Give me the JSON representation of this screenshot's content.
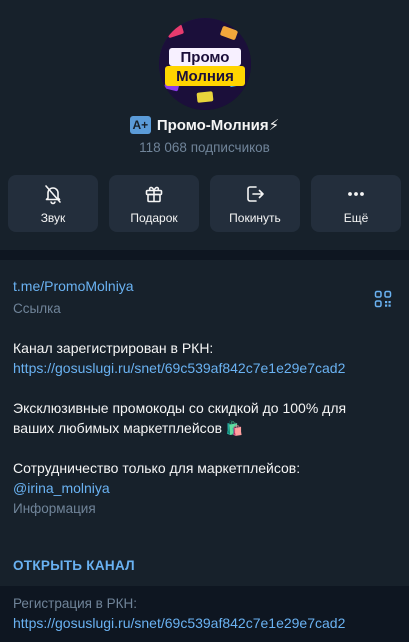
{
  "channel": {
    "title": "Промо-Молния⚡",
    "subscribers": "118 068 подписчиков",
    "badge": "A+",
    "avatar_lines": [
      "Промо",
      "Молния"
    ]
  },
  "actions": [
    {
      "label": "Звук",
      "icon": "bell-off-icon"
    },
    {
      "label": "Подарок",
      "icon": "gift-icon"
    },
    {
      "label": "Покинуть",
      "icon": "leave-icon"
    },
    {
      "label": "Ещё",
      "icon": "more-icon"
    }
  ],
  "info": {
    "link": "t.me/PromoMolniya",
    "link_caption": "Ссылка",
    "desc_line1": "Канал зарегистрирован в РКН:",
    "desc_link1": "https://gosuslugi.ru/snet/69c539af842c7e1e29e7cad2",
    "desc_line2": "Эксклюзивные промокоды со скидкой до 100% для",
    "desc_line3": "ваших любимых маркетплейсов 🛍️",
    "desc_line4": "Сотрудничество только для маркетплейсов:",
    "desc_link2": "@irina_molniya",
    "desc_caption": "Информация",
    "open_channel": "ОТКРЫТЬ КАНАЛ"
  },
  "footer": {
    "line1": "Регистрация в РКН:",
    "link": "https://gosuslugi.ru/snet/69c539af842c7e1e29e7cad2"
  },
  "colors": {
    "background": "#17212b",
    "tile": "#232e3c",
    "accent": "#6ab2f2",
    "muted": "#708499"
  }
}
